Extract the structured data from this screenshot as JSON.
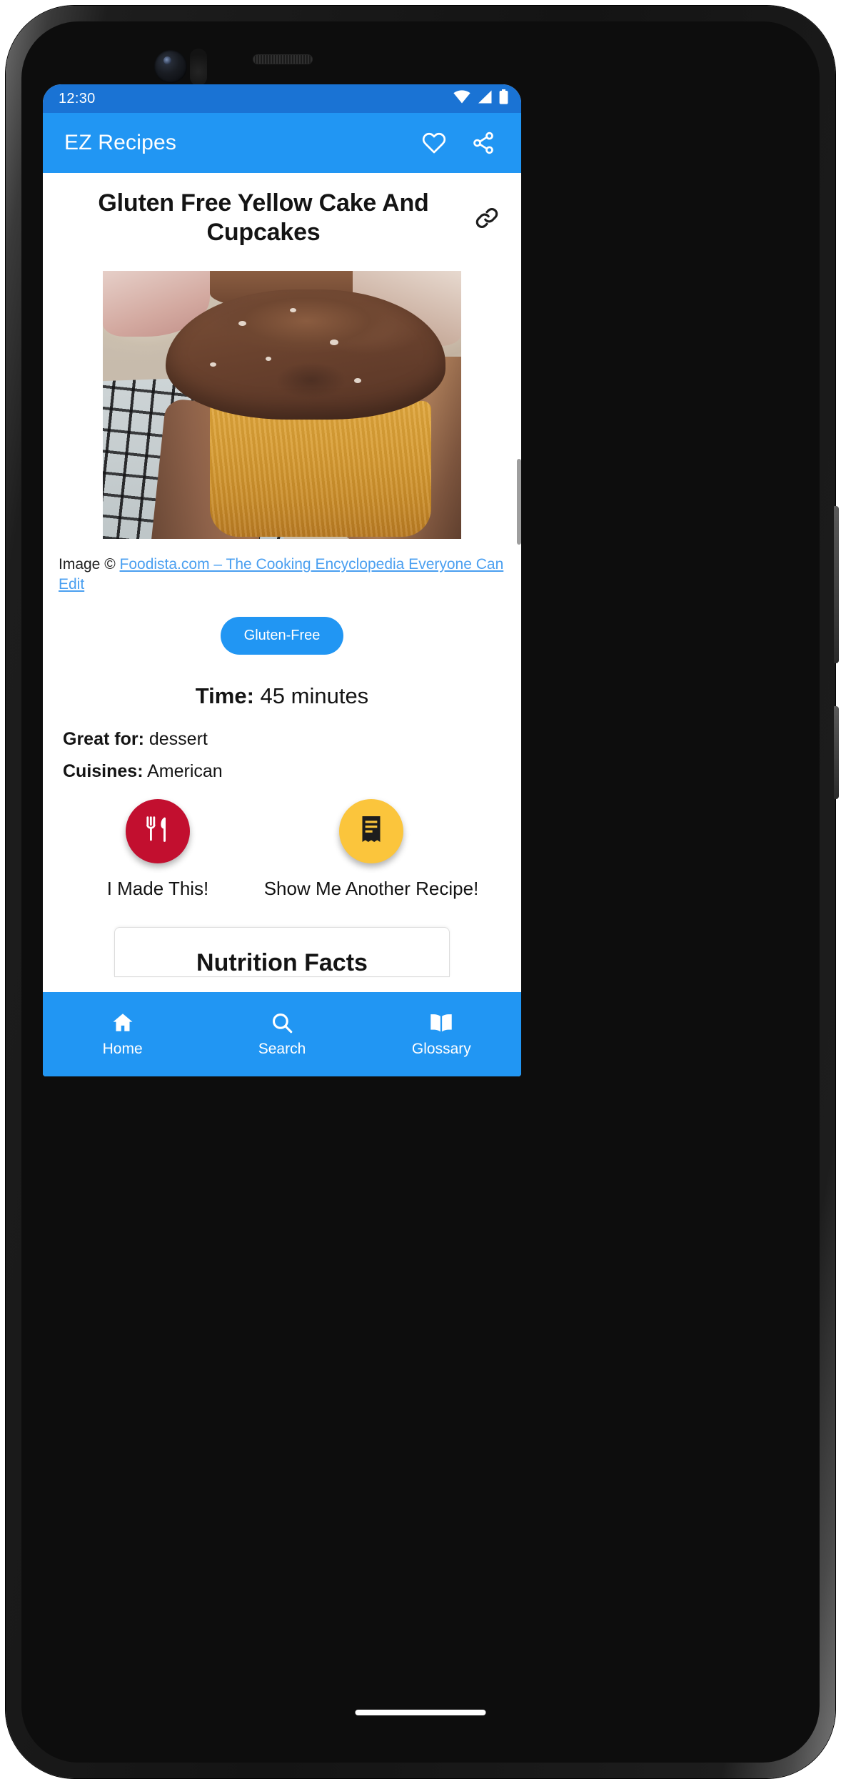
{
  "status_bar": {
    "time": "12:30",
    "icons": [
      "wifi-icon",
      "cell-signal-icon",
      "battery-icon"
    ]
  },
  "app_bar": {
    "title": "EZ Recipes",
    "favorite_icon": "heart-outline-icon",
    "share_icon": "share-icon"
  },
  "recipe": {
    "title": "Gluten Free Yellow Cake And Cupcakes",
    "link_icon": "link-icon",
    "image_alt": "Chocolate frosted yellow cupcake on a cooling rack",
    "attribution_prefix": "Image © ",
    "attribution_link": "Foodista.com – The Cooking Encyclopedia Everyone Can Edit",
    "tags": [
      "Gluten-Free"
    ],
    "time_label": "Time:",
    "time_value": "45 minutes",
    "great_for_label": "Great for:",
    "great_for_value": "dessert",
    "cuisines_label": "Cuisines:",
    "cuisines_value": "American"
  },
  "actions": {
    "made_this_label": "I Made This!",
    "made_this_icon": "fork-knife-icon",
    "made_this_color": "#c20f2f",
    "another_recipe_label": "Show Me Another Recipe!",
    "another_recipe_icon": "receipt-icon",
    "another_recipe_color": "#fbc53c"
  },
  "nutrition": {
    "heading": "Nutrition Facts"
  },
  "bottom_nav": {
    "items": [
      {
        "label": "Home",
        "icon": "home-icon"
      },
      {
        "label": "Search",
        "icon": "search-icon"
      },
      {
        "label": "Glossary",
        "icon": "book-icon"
      }
    ]
  },
  "theme": {
    "primary": "#2196f3",
    "status_bar": "#1a73d4",
    "link": "#4a9ff0"
  }
}
